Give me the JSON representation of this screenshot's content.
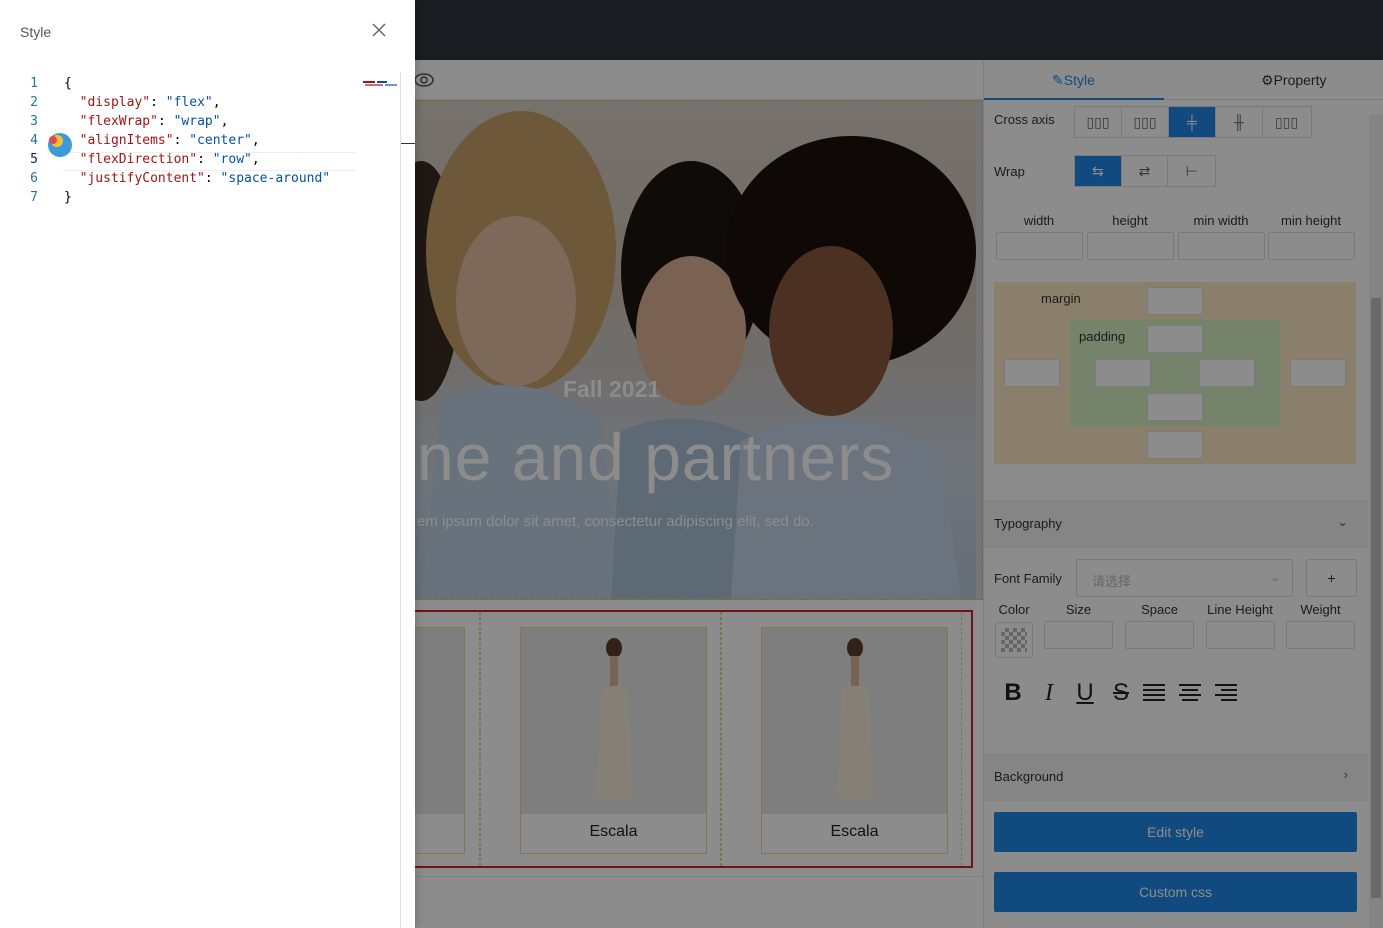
{
  "canvas": {
    "hero": {
      "kicker": "Fall 2021",
      "title": "ne and partners",
      "body": "em ipsum dolor sit amet, consectetur adipiscing elit, sed do."
    },
    "products": [
      {
        "name": ""
      },
      {
        "name": "Escala"
      },
      {
        "name": "Escala"
      }
    ]
  },
  "right_panel": {
    "tabs": [
      {
        "label": "Style",
        "icon": "edit-icon",
        "active": true
      },
      {
        "label": "Property",
        "icon": "gear-icon",
        "active": false
      }
    ],
    "cross_axis": {
      "label": "Cross axis",
      "options": [
        "flex-start",
        "flex-end",
        "center",
        "baseline",
        "stretch"
      ],
      "selected": "center"
    },
    "wrap": {
      "label": "Wrap",
      "options": [
        "wrap",
        "wrap-reverse",
        "nowrap"
      ],
      "selected": "wrap"
    },
    "sizes": {
      "width": "width",
      "height": "height",
      "min_width": "min width",
      "min_height": "min height"
    },
    "box_model": {
      "margin_label": "margin",
      "padding_label": "padding"
    },
    "typography": {
      "title": "Typography",
      "font_family_label": "Font Family",
      "font_family_placeholder": "请选择",
      "add_label": "+",
      "color_label": "Color",
      "size_label": "Size",
      "space_label": "Space",
      "line_height_label": "Line Height",
      "weight_label": "Weight",
      "format_buttons": [
        "B",
        "I",
        "U",
        "S"
      ]
    },
    "background": {
      "title": "Background"
    },
    "edit_style_label": "Edit style",
    "custom_css_label": "Custom css"
  },
  "drawer": {
    "title": "Style",
    "code_lines": [
      {
        "n": "1",
        "key": "",
        "value": "",
        "raw": "{"
      },
      {
        "n": "2",
        "key": "\"display\"",
        "value": "\"flex\"",
        "raw": ""
      },
      {
        "n": "3",
        "key": "\"flexWrap\"",
        "value": "\"wrap\"",
        "raw": ""
      },
      {
        "n": "4",
        "key": "\"alignItems\"",
        "value": "\"center\"",
        "raw": ""
      },
      {
        "n": "5",
        "key": "\"flexDirection\"",
        "value": "\"row\"",
        "raw": ""
      },
      {
        "n": "6",
        "key": "\"justifyContent\"",
        "value": "\"space-around\"",
        "raw": ""
      },
      {
        "n": "7",
        "key": "",
        "value": "",
        "raw": "}"
      }
    ],
    "current_line": 5
  },
  "colors": {
    "accent": "#1e88e5",
    "selection_border": "#c9242b",
    "margin_bg": "#fbe8c4",
    "padding_bg": "#d3efc2",
    "topbar": "#2f343c"
  }
}
